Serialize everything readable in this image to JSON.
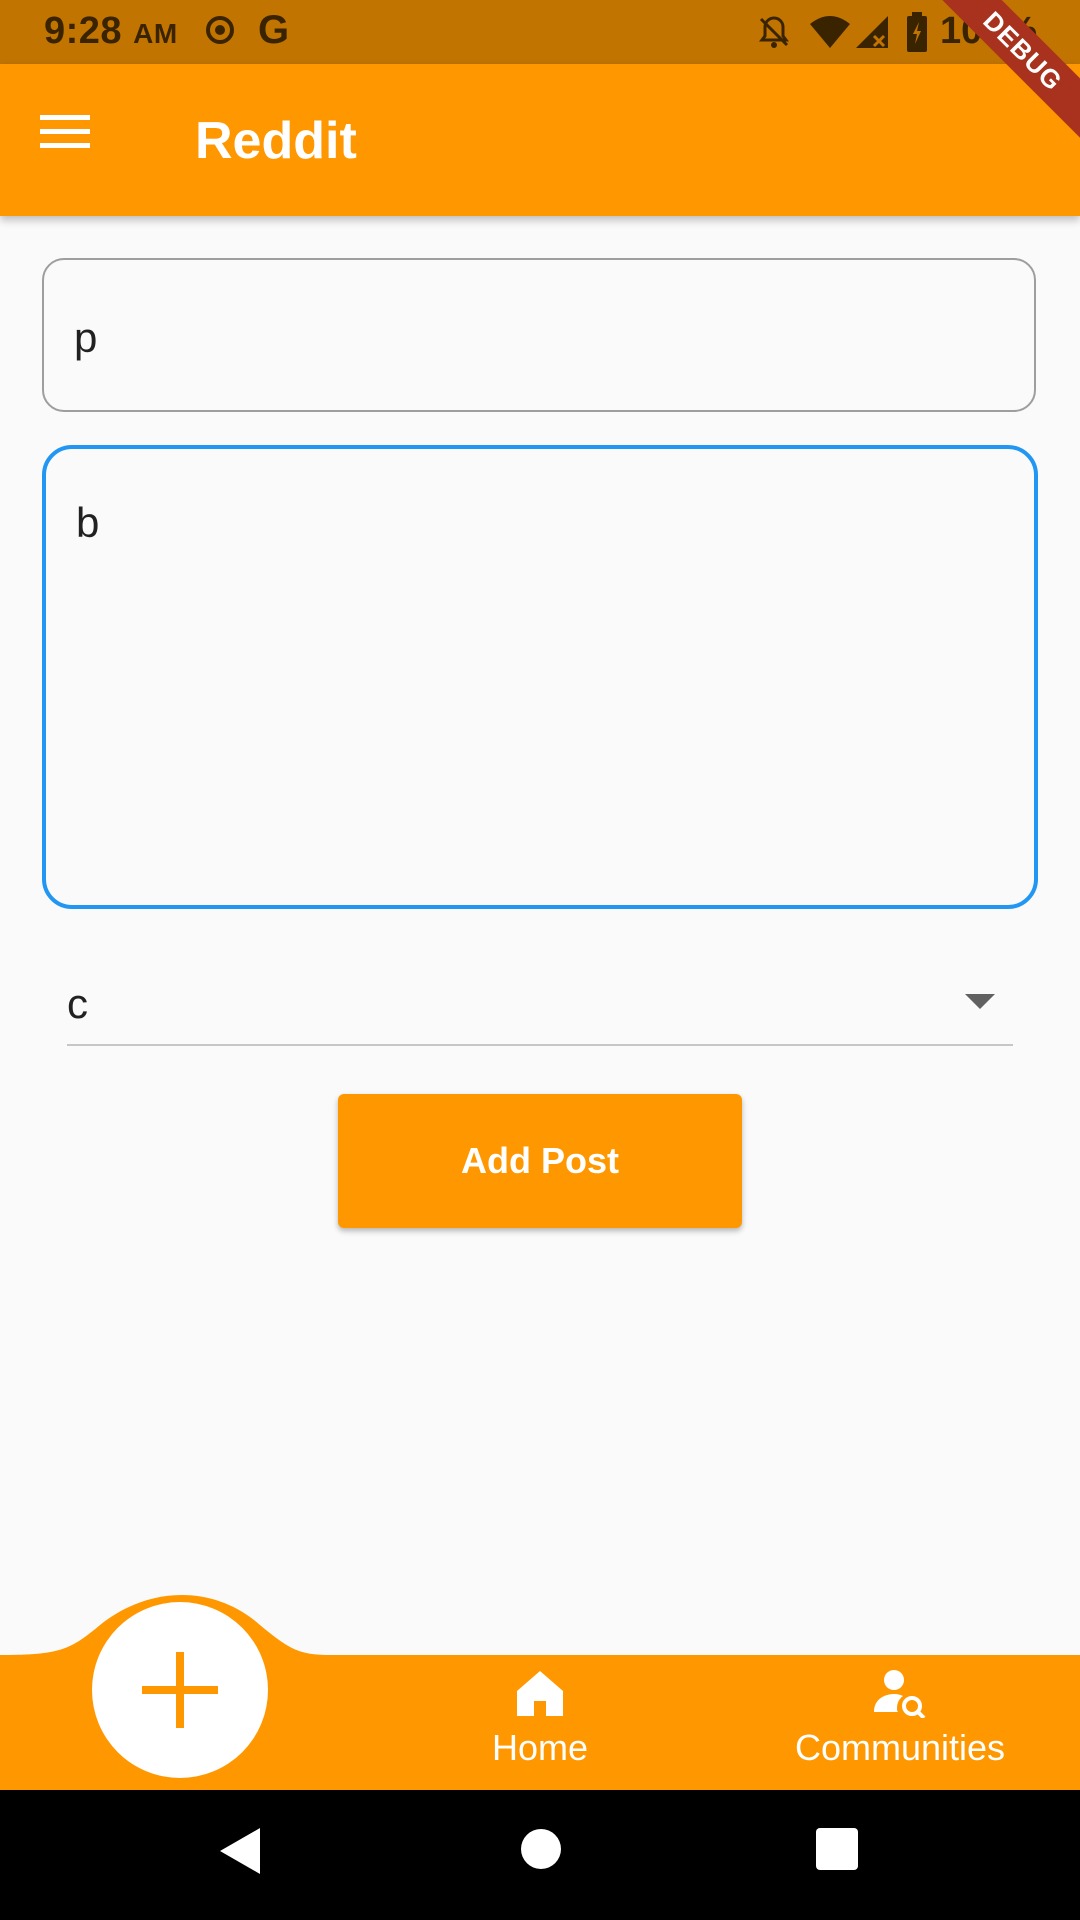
{
  "status_bar": {
    "time": "9:28",
    "ampm": "AM",
    "battery": "100%",
    "icons": [
      "location-icon",
      "google-icon",
      "notifications-off-icon",
      "wifi-icon",
      "signal-icon",
      "battery-charging-icon"
    ]
  },
  "debug_banner": "DEBUG",
  "app_bar": {
    "title": "Reddit",
    "menu_icon": "hamburger-menu-icon"
  },
  "form": {
    "title_value": "p",
    "body_value": "b",
    "community_value": "c",
    "submit_label": "Add Post"
  },
  "bottom_nav": {
    "fab_icon": "plus-icon",
    "items": [
      {
        "label": "Home",
        "icon": "home-icon"
      },
      {
        "label": "Communities",
        "icon": "person-search-icon"
      }
    ]
  },
  "colors": {
    "primary": "#ff9800",
    "status_bar": "#c17400",
    "focused_border": "#2196f3",
    "ribbon": "#a8321e"
  }
}
